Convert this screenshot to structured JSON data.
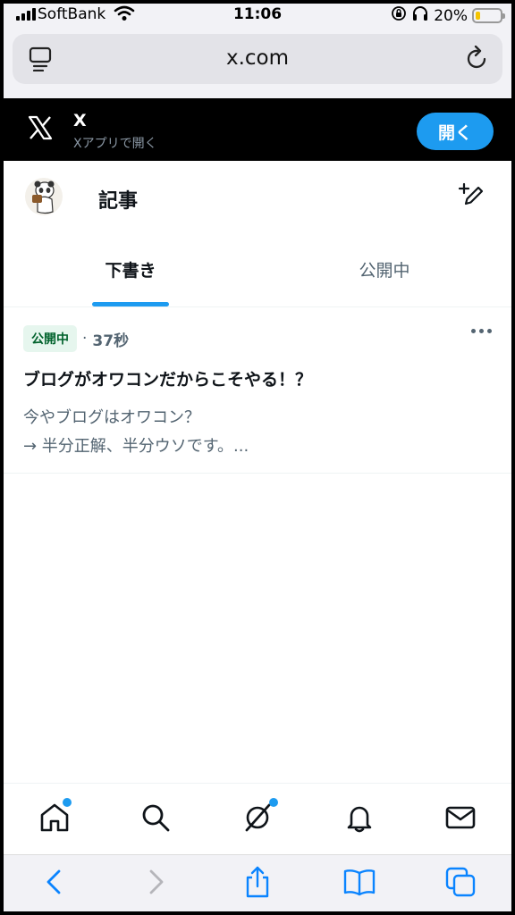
{
  "status_bar": {
    "carrier": "SoftBank",
    "time": "11:06",
    "battery": "20%",
    "battery_level": 0.2
  },
  "browser": {
    "url": "x.com"
  },
  "app_banner": {
    "app_name": "X",
    "subtitle": "Xアプリで開く",
    "open_label": "開く"
  },
  "header": {
    "title": "記事"
  },
  "tabs": [
    {
      "label": "下書き",
      "active": true
    },
    {
      "label": "公開中",
      "active": false
    }
  ],
  "article": {
    "badge": "公開中",
    "separator": "·",
    "time": "37秒",
    "headline": "ブログがオワコンだからこそやる！？",
    "excerpt_line1": "今やブログはオワコン？",
    "excerpt_line2": "→ 半分正解、半分ウソです。..."
  },
  "colors": {
    "accent": "#1d9bf0",
    "badge_bg": "#e6f6ee",
    "badge_text": "#00622c",
    "secondary_text": "#536471"
  },
  "icons": {
    "bottom_nav": [
      "home-icon",
      "search-icon",
      "grok-icon",
      "notifications-icon",
      "messages-icon"
    ],
    "safari": [
      "back-icon",
      "forward-icon",
      "share-icon",
      "bookmarks-icon",
      "tabs-icon"
    ]
  }
}
